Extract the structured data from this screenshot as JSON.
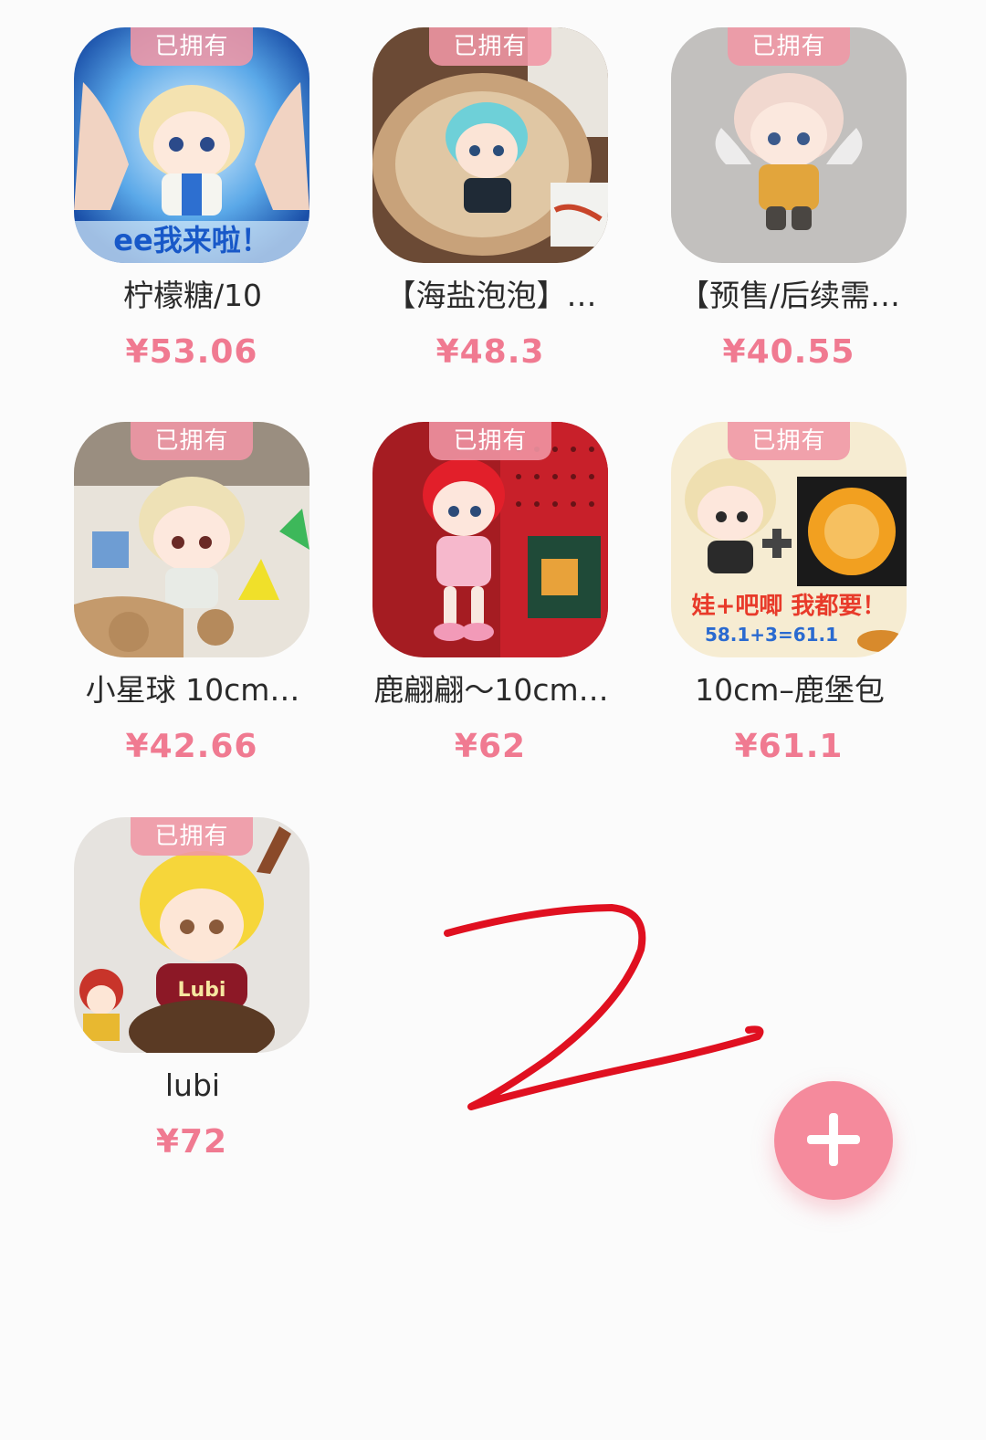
{
  "badge_label": "已拥有",
  "colors": {
    "accent": "#f07a91",
    "fab": "#f58a9c",
    "badge": "#f096a5",
    "scribble": "#e01020"
  },
  "items": [
    {
      "title": "柠檬糖/10",
      "price": "¥53.06",
      "owned": true,
      "image_text": "ee我来啦！"
    },
    {
      "title": "【海盐泡泡】…",
      "price": "¥48.3",
      "owned": true
    },
    {
      "title": "【预售/后续需…",
      "price": "¥40.55",
      "owned": true
    },
    {
      "title": "小星球 10cm…",
      "price": "¥42.66",
      "owned": true
    },
    {
      "title": "鹿翩翩～10cm…",
      "price": "¥62",
      "owned": true
    },
    {
      "title": "10cm–鹿堡包",
      "price": "¥61.1",
      "owned": true,
      "image_text": "娃+吧唧 我都要！",
      "image_text2": "58.1+3=61.1"
    },
    {
      "title": "lubi",
      "price": "¥72",
      "owned": true,
      "image_text": "Lubi"
    }
  ],
  "fab_icon": "plus-icon",
  "annotation": "2"
}
